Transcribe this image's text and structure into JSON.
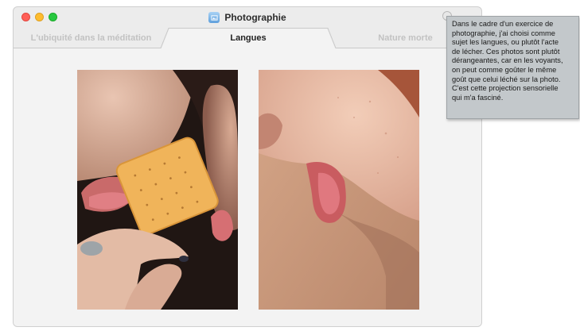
{
  "window": {
    "title": "Photographie",
    "app_icon": "photo-app-icon"
  },
  "tabs": [
    {
      "label": "L'ubiquité dans la méditation",
      "active": false
    },
    {
      "label": "Langues",
      "active": true
    },
    {
      "label": "Nature morte",
      "active": false
    }
  ],
  "photos": [
    {
      "name": "tongues-cracker-photo",
      "description_icon": "photo"
    },
    {
      "name": "tongue-neck-photo",
      "description_icon": "photo"
    }
  ],
  "tooltip": {
    "text": "Dans le cadre d'un exercice de\nphotographie, j'ai choisi comme\nsujet les langues, ou plutôt l'acte\nde lécher. Ces photos sont plutôt\ndérangeantes, car en les voyants,\non peut comme goûter le même\ngoût que celui léché sur la photo.\nC'est cette projection sensorielle\nqui m'a fasciné."
  },
  "colors": {
    "close": "#ff5f57",
    "minimize": "#febc2e",
    "zoom": "#28c840",
    "tooltip_bg": "#c3c8cb"
  }
}
